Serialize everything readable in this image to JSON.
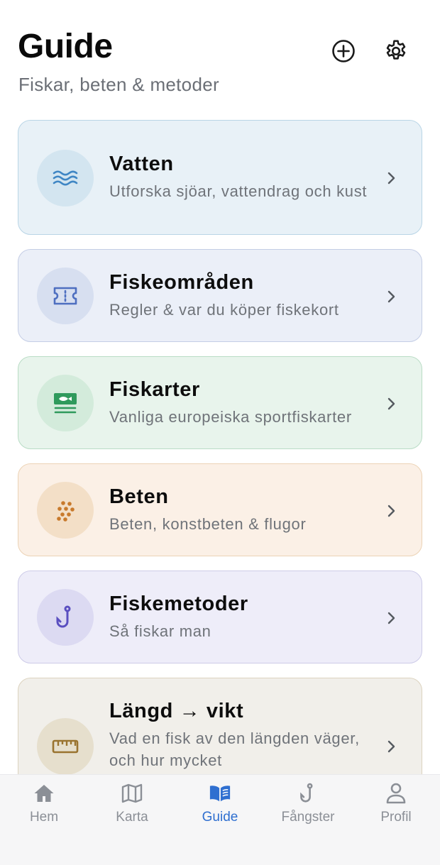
{
  "header": {
    "title": "Guide",
    "subtitle": "Fiskar, beten & metoder",
    "add_icon": "plus-circle-icon",
    "settings_icon": "gear-icon"
  },
  "cards": [
    {
      "title": "Vatten",
      "description": "Utforska sjöar, vattendrag och kust",
      "icon": "waves-icon",
      "bg": "#e8f1f7",
      "border": "#b9d5e6",
      "circle": "#d3e5f0",
      "accent": "#3f86c4"
    },
    {
      "title": "Fiskeområden",
      "description": "Regler & var du köper fiskekort",
      "icon": "ticket-icon",
      "bg": "#ebeff8",
      "border": "#c4cde5",
      "circle": "#d7dff0",
      "accent": "#4e6fc0"
    },
    {
      "title": "Fiskarter",
      "description": "Vanliga europeiska sportfiskarter",
      "icon": "fish-card-icon",
      "bg": "#e8f4ec",
      "border": "#b9dcc5",
      "circle": "#d3ebdb",
      "accent": "#2f9a5c"
    },
    {
      "title": "Beten",
      "description": "Beten, konstbeten & flugor",
      "icon": "bait-dots-icon",
      "bg": "#fbf0e6",
      "border": "#ecd3b6",
      "circle": "#f3dfc7",
      "accent": "#c87a2c"
    },
    {
      "title": "Fiskemetoder",
      "description": "Så fiskar man",
      "icon": "hook-icon",
      "bg": "#eeedf9",
      "border": "#cdcbe8",
      "circle": "#dcdaf2",
      "accent": "#5a4fc0"
    },
    {
      "title": "Längd → vikt",
      "description": "Vad en fisk av den längden väger, och hur mycket",
      "icon": "ruler-icon",
      "bg": "#f1efea",
      "border": "#dcd3bf",
      "circle": "#e6dfcd",
      "accent": "#9a7430"
    }
  ],
  "tabs": [
    {
      "label": "Hem",
      "icon": "home-icon",
      "active": false
    },
    {
      "label": "Karta",
      "icon": "map-icon",
      "active": false
    },
    {
      "label": "Guide",
      "icon": "book-icon",
      "active": true
    },
    {
      "label": "Fångster",
      "icon": "hook-icon",
      "active": false
    },
    {
      "label": "Profil",
      "icon": "person-icon",
      "active": false
    }
  ],
  "colors": {
    "tab_active": "#2f6fd0",
    "tab_inactive": "#8b8f96"
  }
}
